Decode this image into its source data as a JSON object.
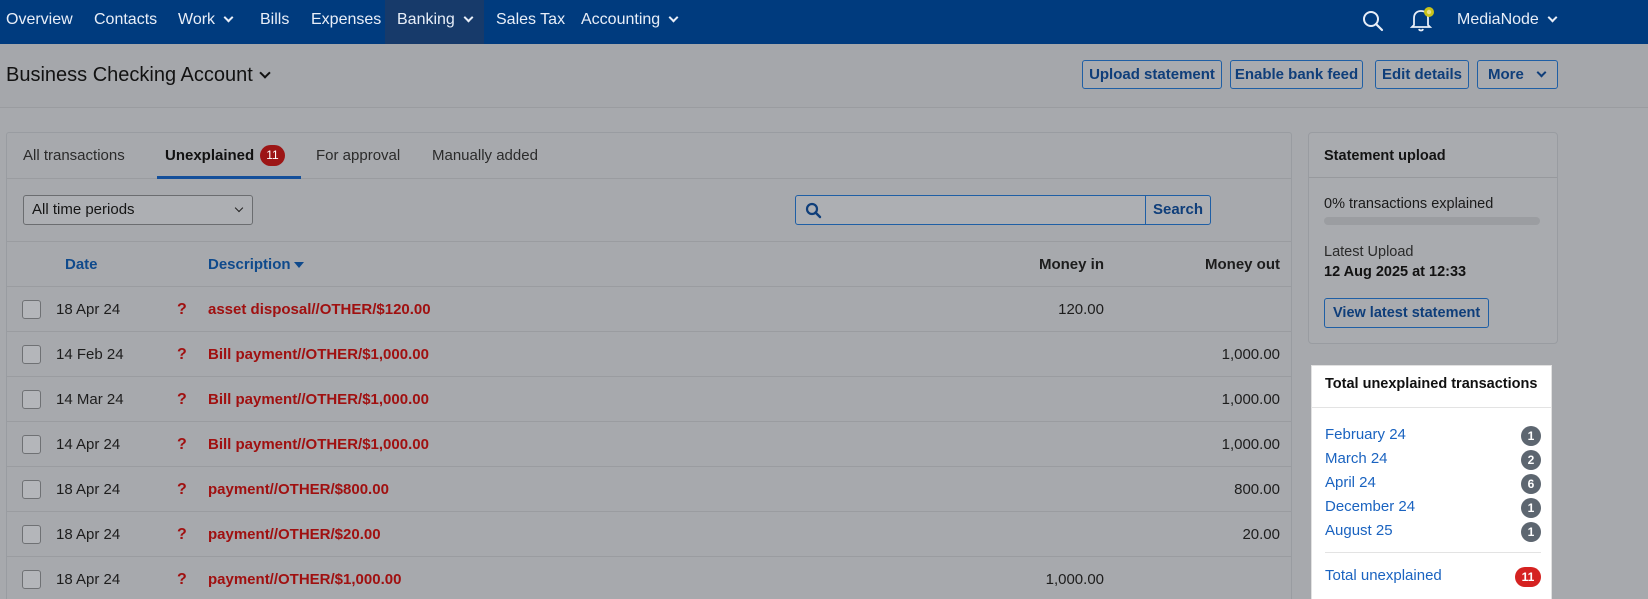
{
  "nav": {
    "items": [
      {
        "label": "Overview"
      },
      {
        "label": "Contacts"
      },
      {
        "label": "Work"
      },
      {
        "label": "Bills"
      },
      {
        "label": "Expenses"
      },
      {
        "label": "Banking"
      },
      {
        "label": "Sales Tax"
      },
      {
        "label": "Accounting"
      }
    ],
    "account_name": "MediaNode",
    "active_item": "Banking"
  },
  "header": {
    "title": "Business Checking Account",
    "buttons": {
      "upload_statement": "Upload statement",
      "enable_bank_feed": "Enable bank feed",
      "edit_details": "Edit details",
      "more": "More"
    }
  },
  "tabs": [
    {
      "label": "All transactions"
    },
    {
      "label": "Unexplained",
      "badge": "11"
    },
    {
      "label": "For approval"
    },
    {
      "label": "Manually added"
    }
  ],
  "filters": {
    "period": "All time periods",
    "search_value": "",
    "search_button": "Search"
  },
  "table": {
    "columns": {
      "date": "Date",
      "description": "Description",
      "money_in": "Money in",
      "money_out": "Money out"
    },
    "rows": [
      {
        "date": "18 Apr 24",
        "status": "?",
        "description": "asset disposal//OTHER/$120.00",
        "money_in": "120.00",
        "money_out": ""
      },
      {
        "date": "14 Feb 24",
        "status": "?",
        "description": "Bill payment//OTHER/$1,000.00",
        "money_in": "",
        "money_out": "1,000.00"
      },
      {
        "date": "14 Mar 24",
        "status": "?",
        "description": "Bill payment//OTHER/$1,000.00",
        "money_in": "",
        "money_out": "1,000.00"
      },
      {
        "date": "14 Apr 24",
        "status": "?",
        "description": "Bill payment//OTHER/$1,000.00",
        "money_in": "",
        "money_out": "1,000.00"
      },
      {
        "date": "18 Apr 24",
        "status": "?",
        "description": "payment//OTHER/$800.00",
        "money_in": "",
        "money_out": "800.00"
      },
      {
        "date": "18 Apr 24",
        "status": "?",
        "description": "payment//OTHER/$20.00",
        "money_in": "",
        "money_out": "20.00"
      },
      {
        "date": "18 Apr 24",
        "status": "?",
        "description": "payment//OTHER/$1,000.00",
        "money_in": "1,000.00",
        "money_out": ""
      }
    ]
  },
  "statement_upload": {
    "title": "Statement upload",
    "explained_text": "0% transactions explained",
    "explained_fraction": 0,
    "latest_label": "Latest Upload",
    "latest_value": "12 Aug 2025 at 12:33",
    "view_button": "View latest statement"
  },
  "unexplained": {
    "title": "Total unexplained transactions",
    "months": [
      {
        "label": "February 24",
        "count": "1"
      },
      {
        "label": "March 24",
        "count": "2"
      },
      {
        "label": "April 24",
        "count": "6"
      },
      {
        "label": "December 24",
        "count": "1"
      },
      {
        "label": "August 25",
        "count": "1"
      }
    ],
    "total_label": "Total unexplained",
    "total_count": "11"
  },
  "colors": {
    "nav_bg": "#003b7e",
    "accent_blue": "#1f5fa5",
    "unexplained_red": "#a01010",
    "badge_red": "#d52221"
  }
}
